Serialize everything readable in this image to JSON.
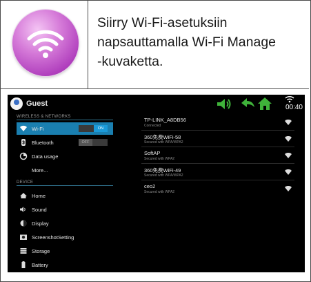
{
  "instruction": "Siirry Wi-Fi-asetuksiin\nnapsauttamalla Wi-Fi Manage\n-kuvaketta.",
  "icon": "wifi-manage-icon",
  "colors": {
    "icon_purple": "#c455cc",
    "selected_blue": "#1a7fb0",
    "status_green": "#3fb23a"
  },
  "android": {
    "user_name": "Guest",
    "time": "00:40",
    "sections": {
      "wireless": "WIRELESS & NETWORKS",
      "device": "DEVICE"
    },
    "menu": [
      {
        "label": "Wi-Fi",
        "icon": "wifi-icon",
        "toggle": "ON",
        "selected": true
      },
      {
        "label": "Bluetooth",
        "icon": "bluetooth-icon",
        "toggle": "OFF"
      },
      {
        "label": "Data usage",
        "icon": "data-usage-icon"
      },
      {
        "label": "More...",
        "icon": ""
      },
      {
        "label": "Home",
        "icon": "home-icon"
      },
      {
        "label": "Sound",
        "icon": "sound-icon"
      },
      {
        "label": "Display",
        "icon": "display-icon"
      },
      {
        "label": "ScreenshotSetting",
        "icon": "screenshot-icon"
      },
      {
        "label": "Storage",
        "icon": "storage-icon"
      },
      {
        "label": "Battery",
        "icon": "battery-icon"
      }
    ],
    "networks": [
      {
        "ssid": "TP-LINK_A8DB56",
        "status": "Connected"
      },
      {
        "ssid": "360免费WiFi-58",
        "status": "Secured with WPA/WPA2"
      },
      {
        "ssid": "SoftAP",
        "status": "Secured with WPA2"
      },
      {
        "ssid": "360免费WiFi-49",
        "status": "Secured with WPA/WPA2"
      },
      {
        "ssid": "ceo2",
        "status": "Secured with WPA2"
      }
    ]
  }
}
